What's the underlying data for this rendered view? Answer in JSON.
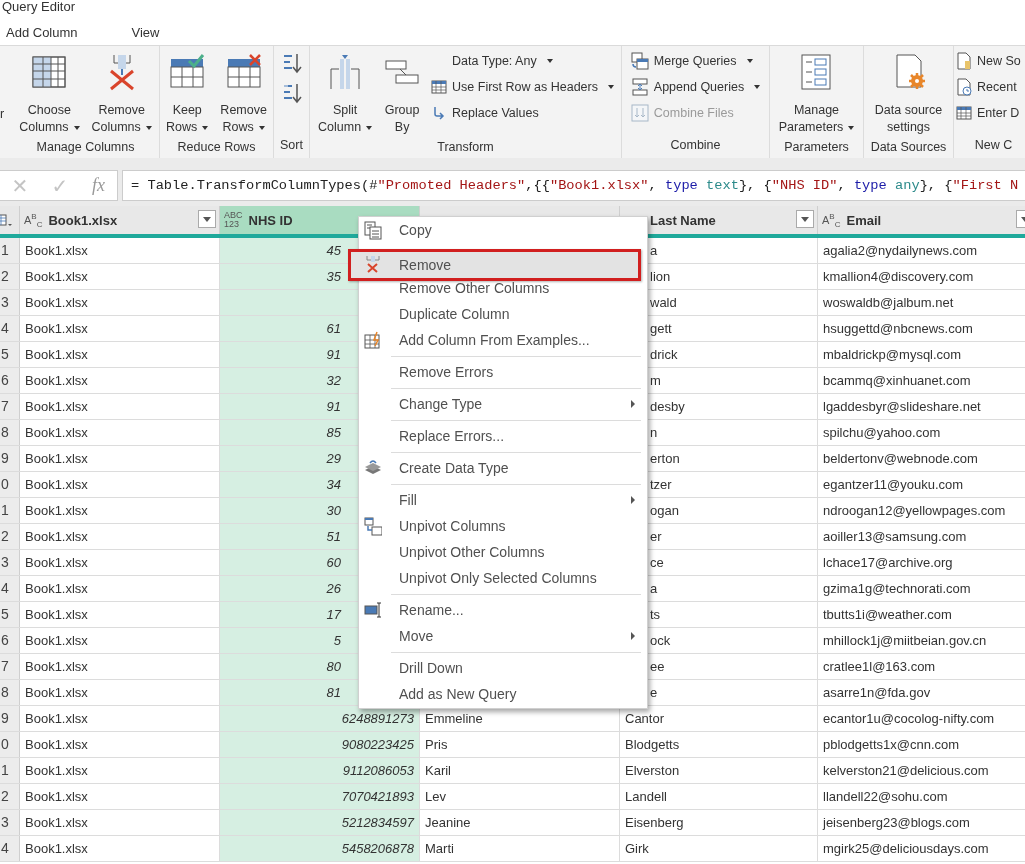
{
  "window": {
    "title": "Query Editor"
  },
  "tabs": [
    {
      "label": "Add Column"
    },
    {
      "label": "View"
    }
  ],
  "ribbon": {
    "groups": [
      {
        "buttons": [
          {
            "kind": "large",
            "lines": [
              "r"
            ],
            "dropdown": false,
            "disabled": false
          }
        ]
      },
      {
        "label": "Manage Columns",
        "buttons": [
          {
            "kind": "large",
            "lines": [
              "Choose",
              "Columns"
            ],
            "dropdown": true,
            "disabled": false
          },
          {
            "kind": "large",
            "lines": [
              "Remove",
              "Columns"
            ],
            "dropdown": true,
            "disabled": false
          }
        ]
      },
      {
        "label": "Reduce Rows",
        "buttons": [
          {
            "kind": "large",
            "lines": [
              "Keep",
              "Rows"
            ],
            "dropdown": true,
            "disabled": false
          },
          {
            "kind": "large",
            "lines": [
              "Remove",
              "Rows"
            ],
            "dropdown": true,
            "disabled": false
          }
        ]
      },
      {
        "label": "Sort",
        "buttons": [
          {
            "kind": "icon",
            "dropdown": false,
            "disabled": false
          },
          {
            "kind": "icon",
            "dropdown": false,
            "disabled": false
          }
        ]
      },
      {
        "label": "Transform",
        "buttons": [
          {
            "kind": "large",
            "lines": [
              "Split",
              "Column"
            ],
            "dropdown": true,
            "disabled": false
          },
          {
            "kind": "large",
            "lines": [
              "Group",
              "By"
            ],
            "dropdown": false,
            "disabled": false
          },
          {
            "kind": "small",
            "lines": [
              "Data Type: Any"
            ],
            "dropdown": true,
            "disabled": false
          },
          {
            "kind": "small",
            "lines": [
              "Use First Row as Headers"
            ],
            "dropdown": true,
            "disabled": false
          },
          {
            "kind": "small",
            "lines": [
              "Replace Values"
            ],
            "dropdown": false,
            "disabled": false
          }
        ]
      },
      {
        "label": "Combine",
        "buttons": [
          {
            "kind": "small",
            "lines": [
              "Merge Queries"
            ],
            "dropdown": true,
            "disabled": false
          },
          {
            "kind": "small",
            "lines": [
              "Append Queries"
            ],
            "dropdown": true,
            "disabled": false
          },
          {
            "kind": "small",
            "lines": [
              "Combine Files"
            ],
            "dropdown": false,
            "disabled": true
          }
        ]
      },
      {
        "label": "Parameters",
        "buttons": [
          {
            "kind": "large",
            "lines": [
              "Manage",
              "Parameters"
            ],
            "dropdown": true,
            "disabled": false
          }
        ]
      },
      {
        "label": "Data Sources",
        "buttons": [
          {
            "kind": "large",
            "lines": [
              "Data source",
              "settings"
            ],
            "dropdown": false,
            "disabled": false
          }
        ]
      },
      {
        "label": "New C",
        "buttons": [
          {
            "kind": "small",
            "lines": [
              "New So"
            ],
            "dropdown": false,
            "disabled": false
          },
          {
            "kind": "small",
            "lines": [
              "Recent"
            ],
            "dropdown": false,
            "disabled": false
          },
          {
            "kind": "small",
            "lines": [
              "Enter D"
            ],
            "dropdown": false,
            "disabled": false
          }
        ]
      }
    ]
  },
  "formula_bar": {
    "cancel": "✕",
    "confirm": "✓",
    "fx": "fx",
    "tokens": [
      {
        "kind": "plain",
        "text": "= Table.TransformColumnTypes(#"
      },
      {
        "kind": "string",
        "text": "\"Promoted Headers\""
      },
      {
        "kind": "plain",
        "text": ",{{"
      },
      {
        "kind": "string",
        "text": "\"Book1.xlsx\""
      },
      {
        "kind": "plain",
        "text": ", "
      },
      {
        "kind": "keyword",
        "text": "type"
      },
      {
        "kind": "typename",
        "text": " text"
      },
      {
        "kind": "plain",
        "text": "}, {"
      },
      {
        "kind": "string",
        "text": "\"NHS ID\""
      },
      {
        "kind": "plain",
        "text": ", "
      },
      {
        "kind": "keyword",
        "text": "type"
      },
      {
        "kind": "typename",
        "text": " any"
      },
      {
        "kind": "plain",
        "text": "}, {"
      },
      {
        "kind": "string",
        "text": "\"First N"
      }
    ]
  },
  "table": {
    "columns": [
      {
        "label": "Book1.xlsx",
        "type_lines": [
          "A$^{B}$$_{C}$"
        ],
        "dropdown": true,
        "selected": false
      },
      {
        "label": "NHS ID",
        "type_lines": [
          "ABC",
          "123"
        ],
        "dropdown": false,
        "selected": true
      },
      {
        "dropdown": false,
        "selected": false
      },
      {
        "label": "Last Name",
        "dropdown": true,
        "selected": false
      },
      {
        "label": "Email",
        "type_lines": [
          "A$^{B}$$_{C}$"
        ],
        "dropdown": true,
        "selected": false
      }
    ],
    "rows": [
      {
        "n": "1",
        "cells": [
          "Book1.xlsx",
          "45",
          null,
          "a",
          "agalia2@nydailynews.com"
        ]
      },
      {
        "n": "2",
        "cells": [
          "Book1.xlsx",
          "35",
          null,
          "lion",
          "kmallion4@discovery.com"
        ]
      },
      {
        "n": "3",
        "cells": [
          "Book1.xlsx",
          null,
          null,
          "wald",
          "woswaldb@jalbum.net"
        ]
      },
      {
        "n": "4",
        "cells": [
          "Book1.xlsx",
          "61",
          null,
          "gett",
          "hsuggettd@nbcnews.com"
        ]
      },
      {
        "n": "5",
        "cells": [
          "Book1.xlsx",
          "91",
          null,
          "drick",
          "mbaldrickp@mysql.com"
        ]
      },
      {
        "n": "6",
        "cells": [
          "Book1.xlsx",
          "32",
          null,
          "m",
          "bcammq@xinhuanet.com"
        ]
      },
      {
        "n": "7",
        "cells": [
          "Book1.xlsx",
          "91",
          null,
          "desby",
          "lgaddesbyr@slideshare.net"
        ]
      },
      {
        "n": "8",
        "cells": [
          "Book1.xlsx",
          "85",
          null,
          "n",
          "spilchu@yahoo.com"
        ]
      },
      {
        "n": "9",
        "cells": [
          "Book1.xlsx",
          "29",
          null,
          "erton",
          "beldertonv@webnode.com"
        ]
      },
      {
        "n": "0",
        "cells": [
          "Book1.xlsx",
          "34",
          null,
          "tzer",
          "egantzer11@youku.com"
        ]
      },
      {
        "n": "1",
        "cells": [
          "Book1.xlsx",
          "30",
          null,
          "ogan",
          "ndroogan12@yellowpages.com"
        ]
      },
      {
        "n": "2",
        "cells": [
          "Book1.xlsx",
          "51",
          null,
          "er",
          "aoiller13@samsung.com"
        ]
      },
      {
        "n": "3",
        "cells": [
          "Book1.xlsx",
          "60",
          null,
          "ce",
          "lchace17@archive.org"
        ]
      },
      {
        "n": "4",
        "cells": [
          "Book1.xlsx",
          "26",
          null,
          "a",
          "gzima1g@technorati.com"
        ]
      },
      {
        "n": "5",
        "cells": [
          "Book1.xlsx",
          "17",
          null,
          "ts",
          "tbutts1i@weather.com"
        ]
      },
      {
        "n": "6",
        "cells": [
          "Book1.xlsx",
          "5",
          null,
          "ock",
          "mhillock1j@miitbeian.gov.cn"
        ]
      },
      {
        "n": "7",
        "cells": [
          "Book1.xlsx",
          "80",
          null,
          "ee",
          "cratlee1l@163.com"
        ]
      },
      {
        "n": "8",
        "cells": [
          "Book1.xlsx",
          "81",
          null,
          "e",
          "asarre1n@fda.gov"
        ]
      },
      {
        "n": "9",
        "cells": [
          "Book1.xlsx",
          "6248891273",
          "Emmeline",
          "Cantor",
          "ecantor1u@cocolog-nifty.com"
        ]
      },
      {
        "n": "0",
        "cells": [
          "Book1.xlsx",
          "9080223425",
          "Pris",
          "Blodgetts",
          "pblodgetts1x@cnn.com"
        ]
      },
      {
        "n": "1",
        "cells": [
          "Book1.xlsx",
          "9112086053",
          "Karil",
          "Elverston",
          "kelverston21@delicious.com"
        ]
      },
      {
        "n": "2",
        "cells": [
          "Book1.xlsx",
          "7070421893",
          "Lev",
          "Landell",
          "llandell22@sohu.com"
        ]
      },
      {
        "n": "3",
        "cells": [
          "Book1.xlsx",
          "5212834597",
          "Jeanine",
          "Eisenberg",
          "jeisenberg23@blogs.com"
        ]
      },
      {
        "n": "4",
        "cells": [
          "Book1.xlsx",
          "5458206878",
          "Marti",
          "Girk",
          "mgirk25@deliciousdays.com"
        ]
      }
    ]
  },
  "context_menu": {
    "items": [
      {
        "kind": "item",
        "label": "Copy",
        "submenu": false,
        "selected": false
      },
      {
        "kind": "item",
        "label": "Remove",
        "submenu": false,
        "selected": true
      },
      {
        "kind": "item",
        "label": "Remove Other Columns",
        "submenu": false,
        "selected": false
      },
      {
        "kind": "item",
        "label": "Duplicate Column",
        "submenu": false,
        "selected": false
      },
      {
        "kind": "item",
        "label": "Add Column From Examples...",
        "submenu": false,
        "selected": false
      },
      {
        "kind": "separator"
      },
      {
        "kind": "item",
        "label": "Remove Errors",
        "submenu": false,
        "selected": false
      },
      {
        "kind": "separator"
      },
      {
        "kind": "item",
        "label": "Change Type",
        "submenu": true,
        "selected": false
      },
      {
        "kind": "separator"
      },
      {
        "kind": "item",
        "label": "Replace Errors...",
        "submenu": false,
        "selected": false
      },
      {
        "kind": "separator"
      },
      {
        "kind": "item",
        "label": "Create Data Type",
        "submenu": false,
        "selected": false
      },
      {
        "kind": "separator"
      },
      {
        "kind": "item",
        "label": "Fill",
        "submenu": true,
        "selected": false
      },
      {
        "kind": "item",
        "label": "Unpivot Columns",
        "submenu": false,
        "selected": false
      },
      {
        "kind": "item",
        "label": "Unpivot Other Columns",
        "submenu": false,
        "selected": false
      },
      {
        "kind": "item",
        "label": "Unpivot Only Selected Columns",
        "submenu": false,
        "selected": false
      },
      {
        "kind": "separator"
      },
      {
        "kind": "item",
        "label": "Rename...",
        "submenu": false,
        "selected": false
      },
      {
        "kind": "item",
        "label": "Move",
        "submenu": true,
        "selected": false
      },
      {
        "kind": "separator"
      },
      {
        "kind": "item",
        "label": "Drill Down",
        "submenu": false,
        "selected": false
      },
      {
        "kind": "item",
        "label": "Add as New Query",
        "submenu": false,
        "selected": false
      }
    ]
  }
}
